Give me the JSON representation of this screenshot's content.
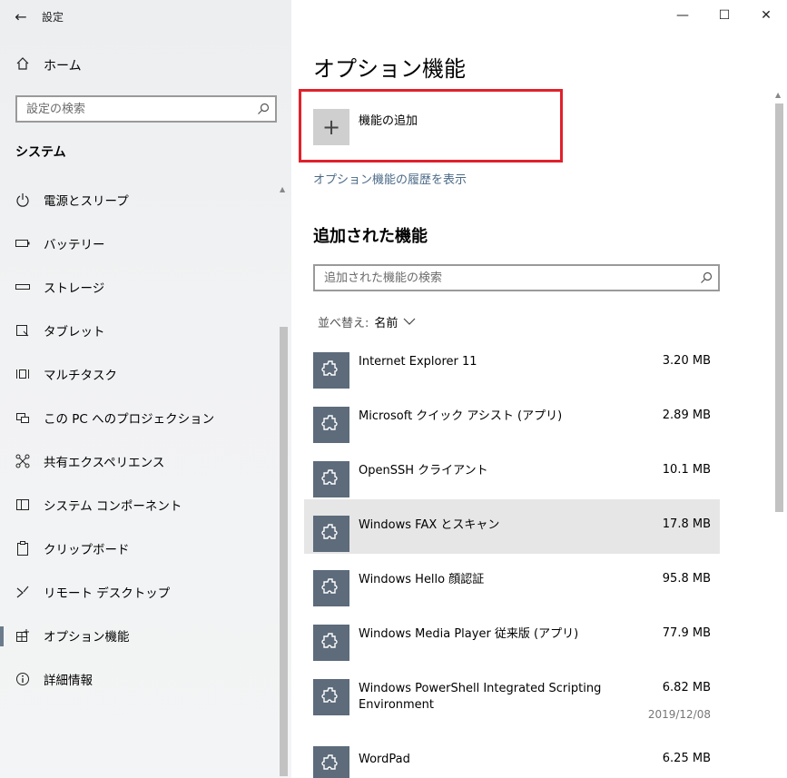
{
  "window": {
    "title": "設定",
    "back_icon": "←",
    "minimize_icon": "—",
    "maximize_icon": "☐",
    "close_icon": "✕"
  },
  "sidebar": {
    "home_label": "ホーム",
    "search_placeholder": "設定の検索",
    "section_title": "システム",
    "items": [
      {
        "label": "電源とスリープ",
        "icon": "power-icon"
      },
      {
        "label": "バッテリー",
        "icon": "battery-icon"
      },
      {
        "label": "ストレージ",
        "icon": "storage-icon"
      },
      {
        "label": "タブレット",
        "icon": "tablet-icon"
      },
      {
        "label": "マルチタスク",
        "icon": "multitask-icon"
      },
      {
        "label": "この PC へのプロジェクション",
        "icon": "projection-icon"
      },
      {
        "label": "共有エクスペリエンス",
        "icon": "shared-experience-icon"
      },
      {
        "label": "システム コンポーネント",
        "icon": "system-components-icon"
      },
      {
        "label": "クリップボード",
        "icon": "clipboard-icon"
      },
      {
        "label": "リモート デスクトップ",
        "icon": "remote-desktop-icon"
      },
      {
        "label": "オプション機能",
        "icon": "optional-features-icon",
        "active": true
      },
      {
        "label": "詳細情報",
        "icon": "info-icon"
      }
    ]
  },
  "main": {
    "page_title": "オプション機能",
    "add_feature_label": "機能の追加",
    "add_icon": "+",
    "history_link": "オプション機能の履歴を表示",
    "installed_title": "追加された機能",
    "search_placeholder": "追加された機能の検索",
    "sort_label": "並べ替え:",
    "sort_value": "名前",
    "features": [
      {
        "name": "Internet Explorer 11",
        "size": "3.20 MB"
      },
      {
        "name": "Microsoft クイック アシスト (アプリ)",
        "size": "2.89 MB"
      },
      {
        "name": "OpenSSH クライアント",
        "size": "10.1 MB"
      },
      {
        "name": "Windows FAX とスキャン",
        "size": "17.8 MB",
        "selected": true
      },
      {
        "name": "Windows Hello 顔認証",
        "size": "95.8 MB"
      },
      {
        "name": "Windows Media Player 従来版 (アプリ)",
        "size": "77.9 MB"
      },
      {
        "name": "Windows PowerShell Integrated Scripting Environment",
        "size": "6.82 MB",
        "date": "2019/12/08"
      },
      {
        "name": "WordPad",
        "size": "6.25 MB"
      }
    ]
  }
}
